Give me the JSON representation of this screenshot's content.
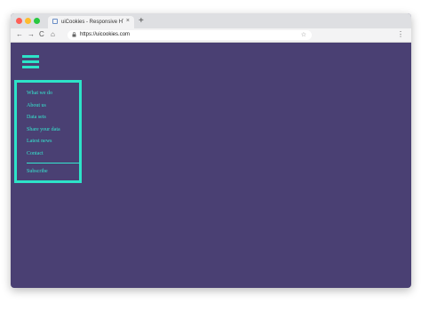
{
  "browser": {
    "tab_title": "uiCookies - Responsive HTML",
    "tab_close": "×",
    "new_tab": "+",
    "url": "https://uicookies.com",
    "back": "←",
    "forward": "→",
    "reload": "C",
    "home": "⌂",
    "star": "☆",
    "menu": "⋮",
    "colors": {
      "close": "#ff5f57",
      "minimize": "#febc2e",
      "zoom": "#28c840"
    }
  },
  "page": {
    "background": "#4a4073",
    "accent": "#2de3c8",
    "menu_icon": "hamburger-icon",
    "nav_items": [
      "What we do",
      "About us",
      "Data sets",
      "Share your data",
      "Latest news",
      "Contact"
    ],
    "subscribe": "Subscribe"
  }
}
